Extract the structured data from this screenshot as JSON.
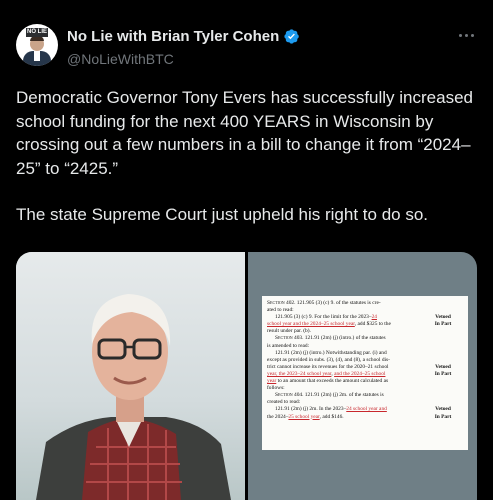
{
  "author": {
    "name": "No Lie with Brian Tyler Cohen",
    "handle": "@NoLieWithBTC",
    "avatar_badge": "NO LIE"
  },
  "tweet": {
    "paragraphs": [
      "Democratic Governor Tony Evers has successfully increased school funding for the next 400 YEARS in Wisconsin by crossing out a few numbers in a bill to change it from “2024–25” to “2425.”",
      "The state Supreme Court just upheld his right to do so."
    ]
  },
  "document": {
    "sec402_head": "Section 402.",
    "sec402_a": "  121.905 (3) (c) 9. of the statutes is cre-",
    "sec402_b": "ated to read:",
    "sec402_c1": "121.905 (3) (c) 9.  For the limit for the 2023–",
    "sec402_c1_red": "24",
    "sec402_c2_red": "school year and the 2024–25 school year",
    "sec402_c2": ", add $325 to the",
    "sec402_c3": "result under par. (b).",
    "veto_label_1": "Vetoed",
    "veto_label_2": "In Part",
    "sec403_head": "Section 403.",
    "sec403_a": "  121.91 (2m) (j) (intro.) of the statutes",
    "sec403_b": "is amended to read:",
    "sec403_c1": "121.91 (2m) (j) (intro.)  Notwithstanding par. (i) and",
    "sec403_c2": "except as provided in subs. (3), (4), and (8), a school dis-",
    "sec403_c3": "trict cannot increase its revenues for the 2020–21 school",
    "sec403_c4_red": "year, the 2023–24 school year",
    "sec403_c4": ", ",
    "sec403_c4_red2": "and the 2024–25 school",
    "sec403_c5_red": "year",
    "sec403_c5": " to an amount that exceeds the amount calculated as",
    "sec403_c6": "follows:",
    "sec404_head": "Section 404.",
    "sec404_a": "  121.91 (2m) (j) 2m. of the statutes is",
    "sec404_b": "created to read:",
    "sec404_c1": "121.91 (2m) (j) 2m.  In the 2023–",
    "sec404_c1_red": "24 school year and",
    "sec404_c2": "the 2024–",
    "sec404_c2_red": "25 school year",
    "sec404_c2b": ", add $146."
  }
}
